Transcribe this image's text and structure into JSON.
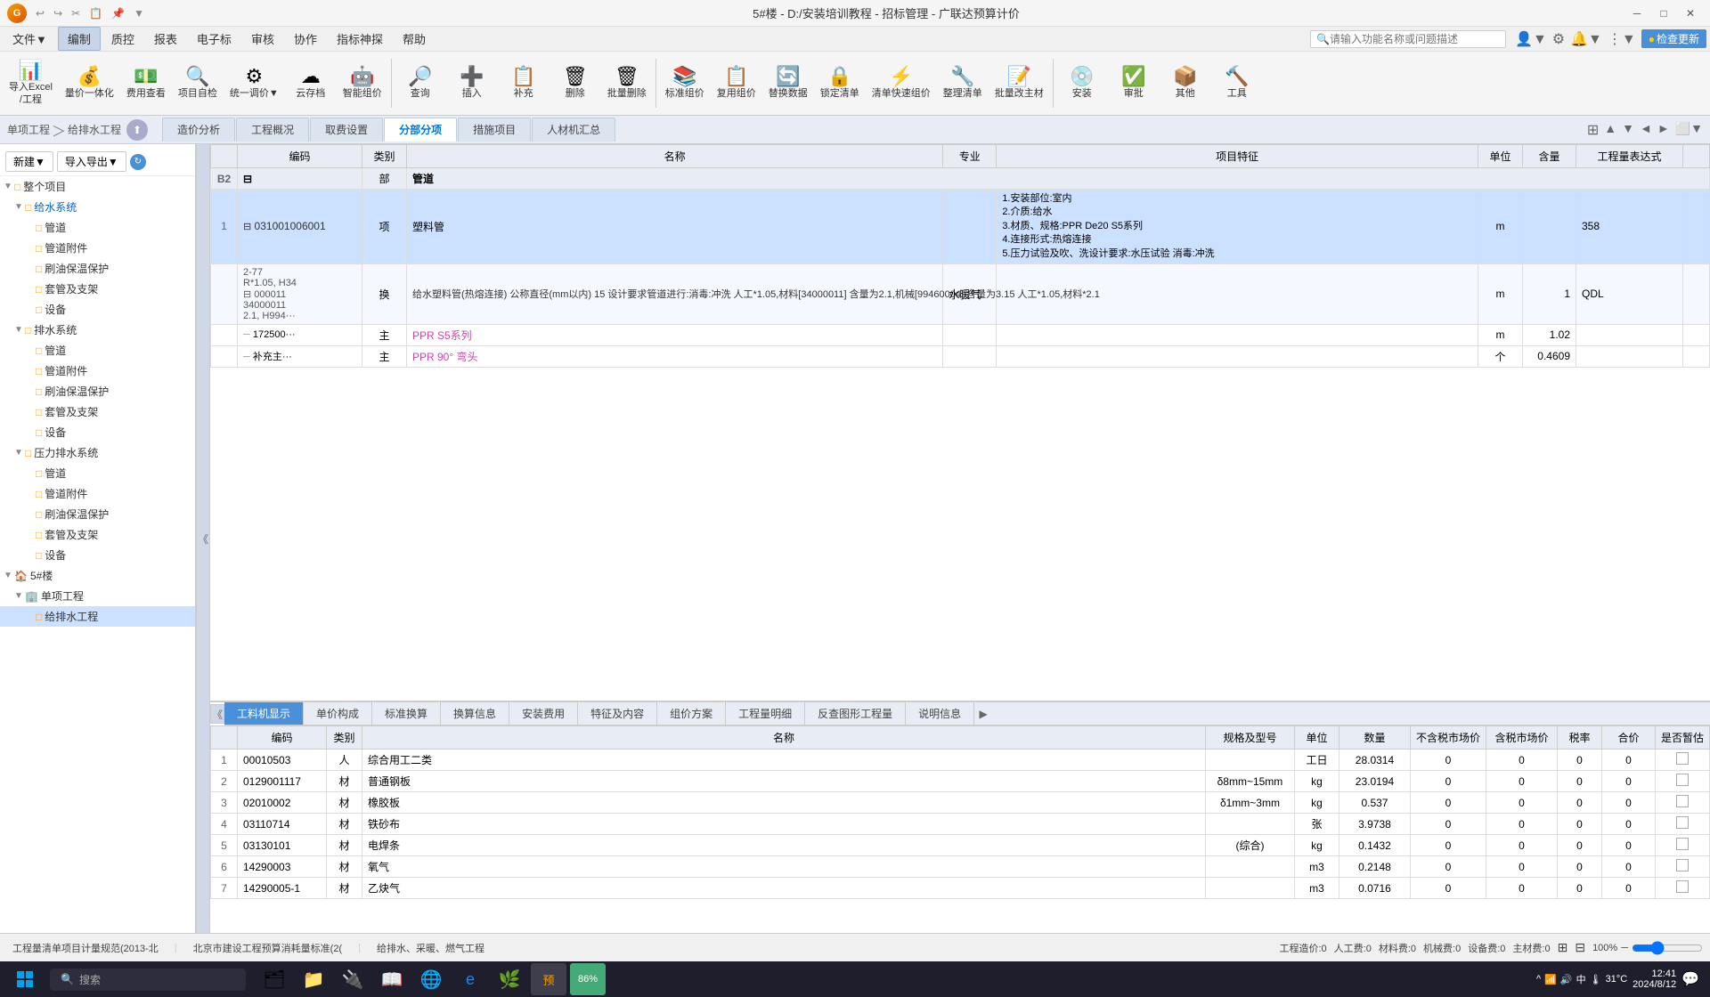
{
  "titlebar": {
    "title": "5#楼 - D:/安装培训教程 - 招标管理 - 广联达预算计价",
    "logo": "G"
  },
  "menubar": {
    "items": [
      "文件▼",
      "编制",
      "质控",
      "报表",
      "电子标",
      "审核",
      "协作",
      "指标神探",
      "帮助"
    ],
    "active_item": "编制",
    "search_placeholder": "请输入功能名称或问题描述",
    "update_btn": "●检查更新"
  },
  "toolbar": {
    "groups": [
      {
        "icon": "📊",
        "label": "导入Excel\n/工程",
        "has_arrow": true
      },
      {
        "icon": "💰",
        "label": "量价一体化",
        "has_arrow": false
      },
      {
        "icon": "💵",
        "label": "费用查看",
        "has_arrow": false
      },
      {
        "icon": "🔍",
        "label": "项目自检",
        "has_arrow": false
      },
      {
        "icon": "⚙",
        "label": "统一调价",
        "has_arrow": true
      },
      {
        "icon": "☁",
        "label": "云存档",
        "has_arrow": false
      },
      {
        "icon": "🤖",
        "label": "智能组价",
        "has_arrow": false
      },
      {
        "sep": true
      },
      {
        "icon": "🔎",
        "label": "查询"
      },
      {
        "icon": "➕",
        "label": "插入"
      },
      {
        "icon": "📋",
        "label": "补充"
      },
      {
        "icon": "🗑",
        "label": "删除"
      },
      {
        "icon": "🗑",
        "label": "批量删除"
      },
      {
        "sep": true
      },
      {
        "icon": "📚",
        "label": "标准组价"
      },
      {
        "icon": "📋",
        "label": "复用组价"
      },
      {
        "icon": "🔄",
        "label": "替换数据"
      },
      {
        "icon": "🔒",
        "label": "锁定清单"
      },
      {
        "icon": "⚡",
        "label": "清单快速组价"
      },
      {
        "icon": "🔧",
        "label": "整理清单"
      },
      {
        "icon": "📝",
        "label": "批量改主材"
      },
      {
        "sep": true
      },
      {
        "icon": "💿",
        "label": "安装"
      },
      {
        "icon": "✅",
        "label": "审批"
      },
      {
        "icon": "📦",
        "label": "其他"
      },
      {
        "icon": "🔨",
        "label": "工具"
      }
    ]
  },
  "navbar": {
    "breadcrumb": [
      "单项工程",
      "给排水工程"
    ],
    "tabs": [
      "造价分析",
      "工程概况",
      "取费设置",
      "分部分项",
      "措施项目",
      "人材机汇总"
    ],
    "active_tab": "分部分项"
  },
  "left_tree": {
    "toolbar_btns": [
      "新建▼",
      "导入导出▼",
      "🔵"
    ],
    "items": [
      {
        "level": 0,
        "expand": "▼",
        "icon": "□",
        "text": "整个项目",
        "folder": true
      },
      {
        "level": 1,
        "expand": "▼",
        "icon": "□",
        "text": "给水系统",
        "folder": true,
        "color": "#0066cc"
      },
      {
        "level": 2,
        "expand": "",
        "icon": "□",
        "text": "管道",
        "folder": true
      },
      {
        "level": 2,
        "expand": "",
        "icon": "□",
        "text": "管道附件",
        "folder": true
      },
      {
        "level": 2,
        "expand": "",
        "icon": "□",
        "text": "刷油保温保护",
        "folder": true
      },
      {
        "level": 2,
        "expand": "",
        "icon": "□",
        "text": "套管及支架",
        "folder": true
      },
      {
        "level": 2,
        "expand": "",
        "icon": "□",
        "text": "设备",
        "folder": true
      },
      {
        "level": 1,
        "expand": "▼",
        "icon": "□",
        "text": "排水系统",
        "folder": true
      },
      {
        "level": 2,
        "expand": "",
        "icon": "□",
        "text": "管道",
        "folder": true
      },
      {
        "level": 2,
        "expand": "",
        "icon": "□",
        "text": "管道附件",
        "folder": true
      },
      {
        "level": 2,
        "expand": "",
        "icon": "□",
        "text": "刷油保温保护",
        "folder": true
      },
      {
        "level": 2,
        "expand": "",
        "icon": "□",
        "text": "套管及支架",
        "folder": true
      },
      {
        "level": 2,
        "expand": "",
        "icon": "□",
        "text": "设备",
        "folder": true
      },
      {
        "level": 1,
        "expand": "▼",
        "icon": "□",
        "text": "压力排水系统",
        "folder": true
      },
      {
        "level": 2,
        "expand": "",
        "icon": "□",
        "text": "管道",
        "folder": true
      },
      {
        "level": 2,
        "expand": "",
        "icon": "□",
        "text": "管道附件",
        "folder": true
      },
      {
        "level": 2,
        "expand": "",
        "icon": "□",
        "text": "刷油保温保护",
        "folder": true
      },
      {
        "level": 2,
        "expand": "",
        "icon": "□",
        "text": "套管及支架",
        "folder": true
      },
      {
        "level": 2,
        "expand": "",
        "icon": "□",
        "text": "设备",
        "folder": true
      },
      {
        "level": 0,
        "expand": "▼",
        "icon": "🏠",
        "text": "5#楼",
        "folder": true
      },
      {
        "level": 1,
        "expand": "▼",
        "icon": "🏢",
        "text": "单项工程",
        "folder": true
      },
      {
        "level": 2,
        "expand": "",
        "icon": "□",
        "text": "给排水工程",
        "folder": true,
        "selected": true
      }
    ]
  },
  "main_table": {
    "columns": [
      "",
      "编码",
      "类别",
      "名称",
      "专业",
      "项目特征",
      "单位",
      "含量",
      "工程量表达式",
      ""
    ],
    "header_row": {
      "code": "",
      "type": "部",
      "name": "管道",
      "row_label": "B2"
    },
    "rows": [
      {
        "row_num": "1",
        "code": "031001006001",
        "type": "项",
        "name": "塑料管",
        "specialty": "",
        "features": "1.安装部位:室内\n2.介质:给水\n3.材质、规格:PPR De20 S5系列\n4.连接形式:热熔连接\n5.压力试验及吹、洗设计要求:水压试验 消毒:冲洗",
        "unit": "m",
        "quantity": "",
        "expr": "358",
        "selected": true,
        "sub_rows": [
          {
            "code": "2-77\nR*1.05,H34\n000011\n34000011\n2.1,H994···",
            "type": "换",
            "name": "给水塑料管(热熔连接) 公称直径(mm以内) 15  设计要求管道进行:消毒:冲洗 人工*1.05,材料[34000011] 含量为2.1,机械[99460004] 含量为3.15  人工*1.05,材料*2.1",
            "specialty": "水暖气",
            "unit": "m",
            "quantity": "1",
            "expr": "QDL"
          },
          {
            "code": "172500···",
            "type": "主",
            "name": "PPR  S5系列",
            "unit": "m",
            "quantity": "1.02",
            "color": "pink"
          },
          {
            "code": "补充主···",
            "type": "主",
            "name": "PPR 90° 弯头",
            "unit": "个",
            "quantity": "0.4609",
            "color": "pink"
          }
        ]
      }
    ]
  },
  "bottom_tabs": [
    "工料机显示",
    "单价构成",
    "标准换算",
    "换算信息",
    "安装费用",
    "特征及内容",
    "组价方案",
    "工程量明细",
    "反查图形工程量",
    "说明信息"
  ],
  "active_bottom_tab": "工料机显示",
  "bottom_table": {
    "columns": [
      "",
      "编码",
      "类别",
      "名称",
      "规格及型号",
      "单位",
      "数量",
      "不含税市场价",
      "含税市场价",
      "税率",
      "合价",
      "是否暂估"
    ],
    "rows": [
      {
        "num": "1",
        "code": "00010503",
        "type": "人",
        "name": "综合用工二类",
        "spec": "",
        "unit": "工日",
        "qty": "28.0314",
        "ex_tax": "0",
        "in_tax": "0",
        "tax_rate": "0",
        "total": "0",
        "est": false
      },
      {
        "num": "2",
        "code": "0129001117",
        "type": "材",
        "name": "普通钢板",
        "spec": "δ8mm~15mm",
        "unit": "kg",
        "qty": "23.0194",
        "ex_tax": "0",
        "in_tax": "0",
        "tax_rate": "0",
        "total": "0",
        "est": false
      },
      {
        "num": "3",
        "code": "02010002",
        "type": "材",
        "name": "橡胶板",
        "spec": "δ1mm~3mm",
        "unit": "kg",
        "qty": "0.537",
        "ex_tax": "0",
        "in_tax": "0",
        "tax_rate": "0",
        "total": "0",
        "est": false
      },
      {
        "num": "4",
        "code": "03110714",
        "type": "材",
        "name": "铁砂布",
        "spec": "",
        "unit": "张",
        "qty": "3.9738",
        "ex_tax": "0",
        "in_tax": "0",
        "tax_rate": "0",
        "total": "0",
        "est": false
      },
      {
        "num": "5",
        "code": "03130101",
        "type": "材",
        "name": "电焊条",
        "spec": "(综合)",
        "unit": "kg",
        "qty": "0.1432",
        "ex_tax": "0",
        "in_tax": "0",
        "tax_rate": "0",
        "total": "0",
        "est": false
      },
      {
        "num": "6",
        "code": "14290003",
        "type": "材",
        "name": "氧气",
        "spec": "",
        "unit": "m3",
        "qty": "0.2148",
        "ex_tax": "0",
        "in_tax": "0",
        "tax_rate": "0",
        "total": "0",
        "est": false
      },
      {
        "num": "7",
        "code": "14290005-1",
        "type": "材",
        "name": "乙炔气",
        "spec": "",
        "unit": "m3",
        "qty": "0.0716",
        "ex_tax": "0",
        "in_tax": "0",
        "tax_rate": "0",
        "total": "0",
        "est": false
      }
    ]
  },
  "statusbar": {
    "items": [
      "工程量清单项目计量规范(2013-北",
      "北京市建设工程预算消耗量标准(2(",
      "给排水、采暖、燃气工程"
    ],
    "right_items": [
      "工程造价:0",
      "人工费:0",
      "材料费:0",
      "机械费:0",
      "设备费:0",
      "主材费:0"
    ],
    "zoom": "100%"
  },
  "taskbar": {
    "apps": [
      "🪟",
      "🗂",
      "📁",
      "🔌",
      "📖",
      "🌐",
      "📧",
      "🌿",
      "💰",
      "86%"
    ],
    "time": "12:41",
    "date": "2024/8/12",
    "weather": "31°C",
    "system_icons": [
      "^",
      "📶",
      "🔊",
      "中",
      "S"
    ]
  }
}
